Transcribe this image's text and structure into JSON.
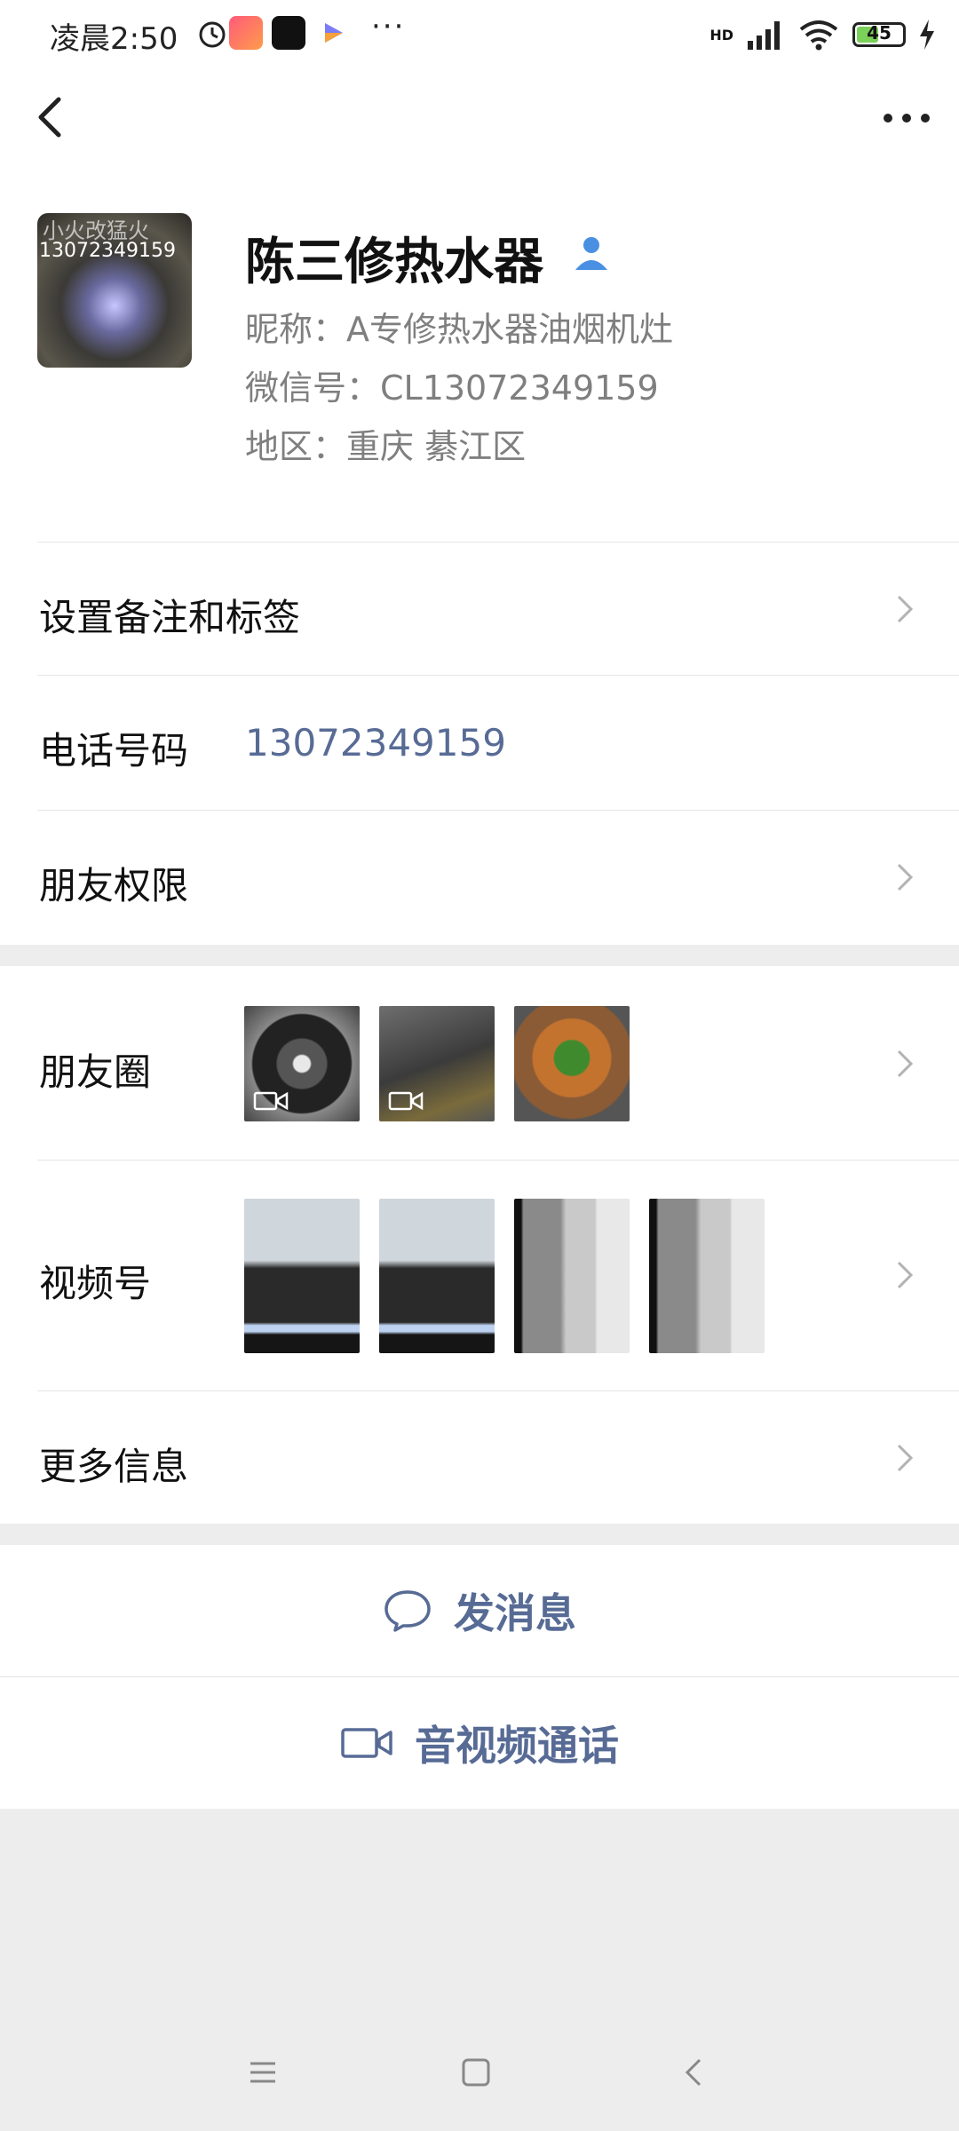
{
  "status_bar": {
    "time": "凌晨2:50",
    "overflow": "···",
    "battery": "45",
    "network": "HD"
  },
  "profile": {
    "display_name": "陈三修热水器",
    "nickname": "昵称：A专修热水器油烟机灶",
    "wechat_id": "微信号：CL13072349159",
    "region": "地区：重庆  綦江区",
    "avatar_text_top": "小火改猛火",
    "avatar_text_number": "13072349159"
  },
  "rows": {
    "remark_tags": "设置备注和标签",
    "phone_label": "电话号码",
    "phone_value": "13072349159",
    "friend_permissions": "朋友权限",
    "moments": "朋友圈",
    "channels": "视频号",
    "more_info": "更多信息"
  },
  "actions": {
    "send_message": "发消息",
    "av_call": "音视频通话"
  },
  "colors": {
    "link": "#576b95",
    "background": "#ededed",
    "verified": "#4a90e2"
  },
  "icons": {
    "back": "chevron-left-icon",
    "more": "more-dots-icon",
    "chat": "chat-bubble-icon",
    "video": "video-camera-icon",
    "verified": "verified-person-icon"
  }
}
